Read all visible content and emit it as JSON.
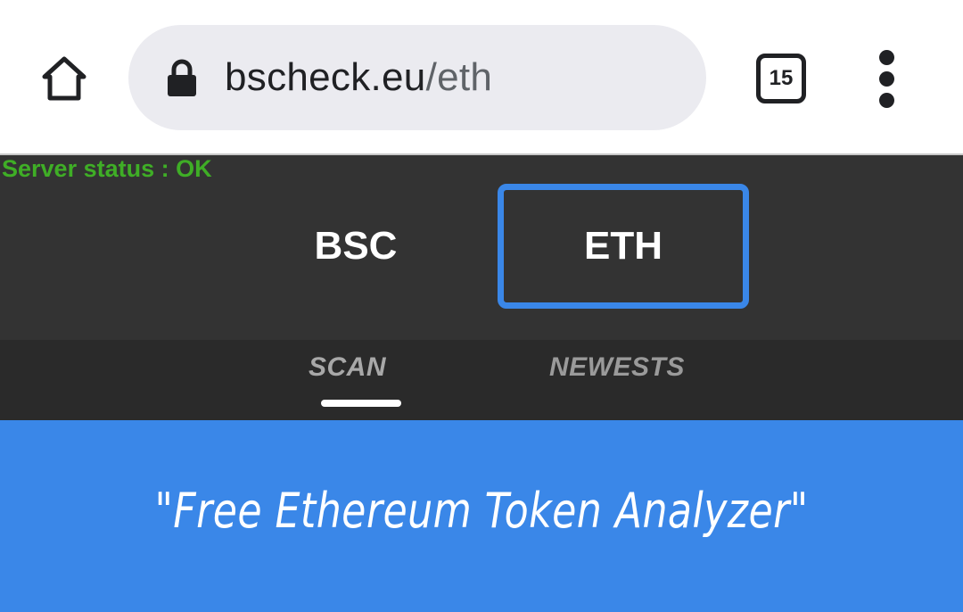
{
  "browser": {
    "url_host": "bscheck.eu",
    "url_path": "/eth",
    "tab_count": "15",
    "icons": {
      "home": "home-icon",
      "lock": "lock-icon",
      "tabs": "tab-switcher-icon",
      "menu": "more-vert-icon"
    }
  },
  "page": {
    "server_status": "Server status : OK",
    "networks": {
      "bsc": "BSC",
      "eth": "ETH",
      "selected": "ETH"
    },
    "subnav": {
      "scan": "SCAN",
      "newests": "NEWESTS",
      "active": "SCAN"
    },
    "hero_title": "\"Free Ethereum Token Analyzer\""
  },
  "colors": {
    "header_bg": "#333333",
    "subnav_bg": "#2a2a2a",
    "accent_blue": "#3a87e8",
    "status_green": "#3fae26"
  }
}
